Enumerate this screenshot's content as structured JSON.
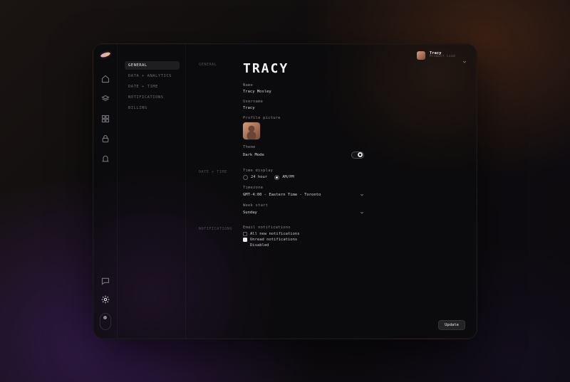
{
  "user": {
    "name": "Tracy",
    "role": "Product Lead"
  },
  "subnav": {
    "items": [
      {
        "label": "General"
      },
      {
        "label": "Data + Analytics"
      },
      {
        "label": "Date + Time"
      },
      {
        "label": "Notifications"
      },
      {
        "label": "Billing"
      }
    ]
  },
  "sections": {
    "general": "General",
    "datetime": "Date + Time",
    "notifications": "Notifications"
  },
  "page": {
    "title": "TRACY"
  },
  "fields": {
    "name_label": "Name",
    "name_value": "Tracy Mosley",
    "username_label": "Username",
    "username_value": "Tracy",
    "picture_label": "Profile picture",
    "theme_label": "Theme",
    "theme_value": "Dark Mode",
    "time_display_label": "Time display",
    "time_24": "24 hour",
    "time_ampm": "AM/PM",
    "timezone_label": "Timezone",
    "timezone_value": "GMT-4:00 - Eastern Time - Toronto",
    "week_start_label": "Week start",
    "week_start_value": "Sunday",
    "email_notif_label": "Email notifications",
    "notif_all": "All new notifications",
    "notif_unread": "Unread notifications",
    "notif_disabled": "Disabled"
  },
  "buttons": {
    "update": "Update"
  }
}
